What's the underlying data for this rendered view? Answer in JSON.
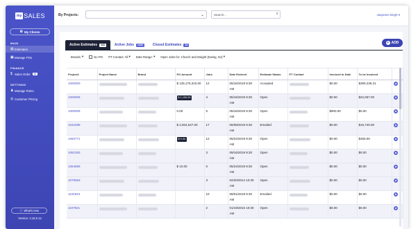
{
  "app": {
    "logo_box": "my",
    "logo_text": "SALES"
  },
  "sidebar": {
    "my_clients": "My Clients",
    "main_heading": "MAIN",
    "main_items": [
      {
        "label": "Estimates"
      },
      {
        "label": "Manage POs"
      }
    ],
    "finance_heading": "FINANCE",
    "finance_items": [
      {
        "label": "Sales Order",
        "badge": "11"
      }
    ],
    "settings_heading": "SETTINGS",
    "settings_items": [
      {
        "label": "Manage Roles"
      },
      {
        "label": "Customer Pricing"
      }
    ],
    "whats_new": "What's new",
    "version": "Version: 3.18.0.12"
  },
  "topbar": {
    "by_projects": "By Projects:",
    "search_placeholder": "Search...",
    "user": "Jaspreet Singh"
  },
  "tabs": [
    {
      "label": "Active Estimates",
      "count": "444"
    },
    {
      "label": "Active Jobs",
      "count": "1434"
    },
    {
      "label": "Closed Estimates",
      "count": "14"
    }
  ],
  "add_label": "ADD",
  "filters": {
    "brands": "Brands:",
    "no_po": "No PO",
    "pt_contact": "PT Contact: All",
    "date_range": "Date Range:",
    "open_jobs": "Open Jobs for: Church and Dwight (Ewing, NJ)"
  },
  "table": {
    "headers": [
      "Project#",
      "Project Name",
      "Brand",
      "PO Amount",
      "Jobs",
      "Date Entered",
      "Estimate Status",
      "PT Contact",
      "Invoiced to Date",
      "To be Invoiced",
      ""
    ],
    "rows": [
      {
        "project": "1000000",
        "po": "$ 125,175,310.00",
        "po_tag": false,
        "jobs": "12",
        "date": "05/16/2019 9:30 AM",
        "status": "Accepted",
        "invoiced": "$0.00",
        "to_be": "$390,239.31"
      },
      {
        "project": "1000006",
        "po": "$ 1,190.00",
        "po_tag": true,
        "jobs": "4",
        "date": "05/16/2019 9:30 AM",
        "status": "Open",
        "invoiced": "$0.00",
        "to_be": "$22,067.00"
      },
      {
        "project": "1000009",
        "po": "0.00",
        "po_tag": false,
        "jobs": "5",
        "date": "05/16/2019 9:30 AM",
        "status": "Open",
        "invoiced": "$900.00",
        "to_be": "$0.00"
      },
      {
        "project": "1042289",
        "po": "$ 2,004,547.00",
        "po_tag": false,
        "jobs": "17",
        "date": "06/08/2019 9:30 AM",
        "status": "Emailed",
        "invoiced": "$0.00",
        "to_be": "$16,740.00"
      },
      {
        "project": "1050771",
        "po": "$ 0.00",
        "po_tag": true,
        "jobs": "12",
        "date": "05/24/2019 9:30 AM",
        "status": "Open",
        "invoiced": "$0.00",
        "to_be": "$450.00"
      },
      {
        "project": "1061353",
        "po": "",
        "po_tag": false,
        "jobs": "3",
        "date": "09/16/2019 9:30 AM",
        "status": "Open",
        "invoiced": "$0.00",
        "to_be": "$0.00"
      },
      {
        "project": "1064589",
        "po": "$ 10.00",
        "po_tag": false,
        "jobs": "0",
        "date": "05/24/2019 9:30 AM",
        "status": "Open",
        "invoiced": "$0.00",
        "to_be": "$0.00"
      },
      {
        "project": "1070653",
        "po": "",
        "po_tag": false,
        "jobs": "3",
        "date": "02/20/2014 10:30 AM",
        "status": "Open",
        "invoiced": "$0.00",
        "to_be": "$0.00"
      },
      {
        "project": "1102943",
        "po": "",
        "po_tag": false,
        "jobs": "10",
        "date": "08/01/2019 9:30 AM",
        "status": "Emailed",
        "invoiced": "$0.00",
        "to_be": "$0.00"
      },
      {
        "project": "1107821",
        "po": "",
        "po_tag": false,
        "jobs": "2",
        "date": "01/19/2016 10:30 AM",
        "status": "Open",
        "invoiced": "$0.00",
        "to_be": "$0.00"
      }
    ]
  },
  "colors": {
    "sidebar": "#4048b8",
    "accent": "#3d45b3",
    "active_tab": "#1e2235"
  }
}
